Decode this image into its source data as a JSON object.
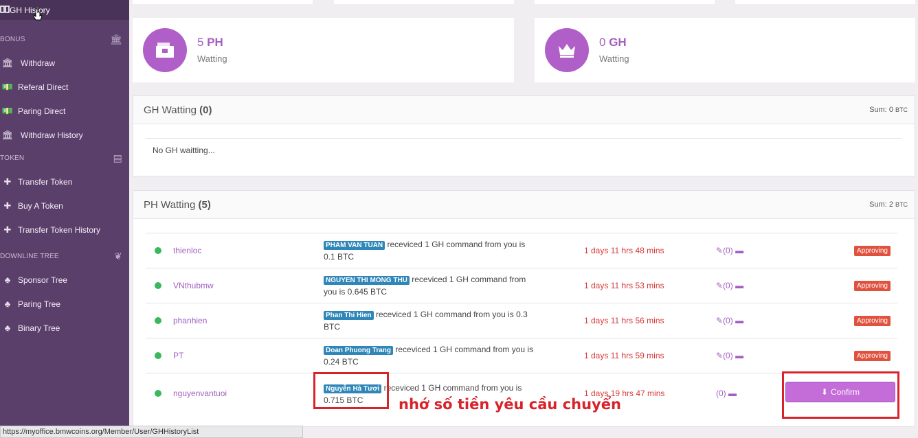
{
  "sidebar": {
    "top_item": {
      "label": "GH History",
      "icon": "book-icon"
    },
    "sections": [
      {
        "title": "BONUS",
        "icon": "bank-icon",
        "items": [
          {
            "label": "Withdraw",
            "icon": "bank-icon"
          },
          {
            "label": "Referal Direct",
            "icon": "money-icon"
          },
          {
            "label": "Paring Direct",
            "icon": "money-icon"
          },
          {
            "label": "Withdraw History",
            "icon": "bank-icon"
          }
        ]
      },
      {
        "title": "TOKEN",
        "icon": "ticket-icon",
        "items": [
          {
            "label": "Transfer Token",
            "icon": "plus-icon"
          },
          {
            "label": "Buy A Token",
            "icon": "plus-icon"
          },
          {
            "label": "Transfer Token History",
            "icon": "plus-icon"
          }
        ]
      },
      {
        "title": "DOWNLINE TREE",
        "icon": "leaf-icon",
        "items": [
          {
            "label": "Sponsor Tree",
            "icon": "tree-icon"
          },
          {
            "label": "Paring Tree",
            "icon": "tree-icon"
          },
          {
            "label": "Binary Tree",
            "icon": "tree-icon"
          }
        ]
      }
    ]
  },
  "stats": {
    "ph": {
      "number": "5",
      "unit": "PH",
      "label": "Watting",
      "icon": "wallet-icon"
    },
    "gh": {
      "number": "0",
      "unit": "GH",
      "label": "Watting",
      "icon": "crown-icon"
    }
  },
  "gh_panel": {
    "title": "GH Watting",
    "count": "(0)",
    "sum_label": "Sum:",
    "sum_value": "0",
    "sum_unit": "BTC",
    "empty_text": "No GH waitting..."
  },
  "ph_panel": {
    "title": "PH Watting",
    "count": "(5)",
    "sum_label": "Sum:",
    "sum_value": "2",
    "sum_unit": "BTC",
    "rows": [
      {
        "user": "thienloc",
        "recipient": "PHAM VAN TUAN",
        "message": "receviced 1 GH command from you is 0.1 BTC",
        "time": "1 days 11 hrs 48 mins",
        "attachments": "(0)",
        "status": "Approving"
      },
      {
        "user": "VNthubmw",
        "recipient": "NGUYEN THI MONG THU",
        "message": "receviced 1 GH command from you is 0.645 BTC",
        "time": "1 days 11 hrs 53 mins",
        "attachments": "(0)",
        "status": "Approving"
      },
      {
        "user": "phanhien",
        "recipient": "Phan Thi Hien",
        "message": "receviced 1 GH command from you is 0.3 BTC",
        "time": "1 days 11 hrs 56 mins",
        "attachments": "(0)",
        "status": "Approving"
      },
      {
        "user": "PT",
        "recipient": "Doan Phuong Trang",
        "message": "receviced 1 GH command from you is 0.24 BTC",
        "time": "1 days 11 hrs 59 mins",
        "attachments": "(0)",
        "status": "Approving"
      },
      {
        "user": "nguyenvantuoi",
        "recipient": "Nguyễn Hà Tươi",
        "message": "receviced 1 GH command from you is 0.715 BTC",
        "time": "1 days 19 hrs 47 mins",
        "attachments": "(0)",
        "status": "Confirm"
      }
    ]
  },
  "confirm_button": {
    "label": "Confirm",
    "icon": "download-icon"
  },
  "annotation": "nhớ số tiền yêu cầu chuyển",
  "statusbar_url": "https://myoffice.bmwcoins.org/Member/User/GHHistoryList",
  "colors": {
    "sidebar": "#5b3f6b",
    "accent": "#b05fc8",
    "label": "#2f86b8",
    "danger": "#e0513e",
    "annotation": "#d8232a"
  }
}
